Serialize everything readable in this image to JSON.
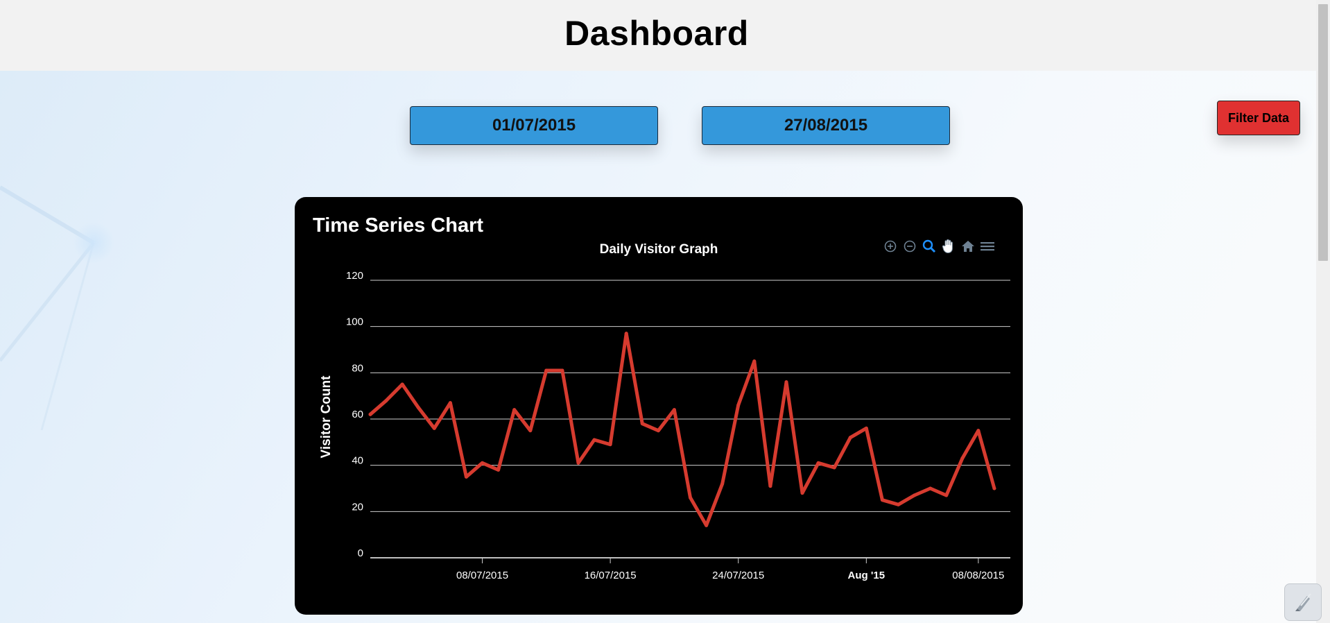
{
  "header": {
    "title": "Dashboard"
  },
  "filters": {
    "start_date": "01/07/2015",
    "end_date": "27/08/2015",
    "filter_label": "Filter Data"
  },
  "card": {
    "title": "Time Series Chart"
  },
  "toolbar": {
    "icons": [
      "zoom-in-icon",
      "zoom-out-icon",
      "zoom-select-icon",
      "pan-hand-icon",
      "home-icon",
      "menu-icon"
    ],
    "active_color": "#1e90ff",
    "inactive_color": "#6e8192"
  },
  "colors": {
    "button_blue": "#3498db",
    "filter_red": "#e03131",
    "series_red": "#d63b2f",
    "card_bg": "#000000"
  },
  "chart_data": {
    "type": "line",
    "title": "Daily Visitor Graph",
    "ylabel": "Visitor Count",
    "xlabel": "",
    "ylim": [
      0,
      120
    ],
    "yticks": [
      0,
      20,
      40,
      60,
      80,
      100,
      120
    ],
    "xlim": [
      "2015-07-01",
      "2015-08-10"
    ],
    "xticks": [
      {
        "date": "2015-07-08",
        "label": "08/07/2015"
      },
      {
        "date": "2015-07-16",
        "label": "16/07/2015"
      },
      {
        "date": "2015-07-24",
        "label": "24/07/2015"
      },
      {
        "date": "2015-08-01",
        "label": "Aug '15",
        "bold": true
      },
      {
        "date": "2015-08-08",
        "label": "08/08/2015"
      }
    ],
    "grid": true,
    "series": [
      {
        "color": "#d63b2f",
        "points": [
          [
            "2015-07-01",
            62
          ],
          [
            "2015-07-02",
            68
          ],
          [
            "2015-07-03",
            75
          ],
          [
            "2015-07-04",
            65
          ],
          [
            "2015-07-05",
            56
          ],
          [
            "2015-07-06",
            67
          ],
          [
            "2015-07-07",
            35
          ],
          [
            "2015-07-08",
            41
          ],
          [
            "2015-07-09",
            38
          ],
          [
            "2015-07-10",
            64
          ],
          [
            "2015-07-11",
            55
          ],
          [
            "2015-07-12",
            81
          ],
          [
            "2015-07-13",
            81
          ],
          [
            "2015-07-14",
            41
          ],
          [
            "2015-07-15",
            51
          ],
          [
            "2015-07-16",
            49
          ],
          [
            "2015-07-17",
            97
          ],
          [
            "2015-07-18",
            58
          ],
          [
            "2015-07-19",
            55
          ],
          [
            "2015-07-20",
            64
          ],
          [
            "2015-07-21",
            26
          ],
          [
            "2015-07-22",
            14
          ],
          [
            "2015-07-23",
            32
          ],
          [
            "2015-07-24",
            66
          ],
          [
            "2015-07-25",
            85
          ],
          [
            "2015-07-26",
            31
          ],
          [
            "2015-07-27",
            76
          ],
          [
            "2015-07-28",
            28
          ],
          [
            "2015-07-29",
            41
          ],
          [
            "2015-07-30",
            39
          ],
          [
            "2015-07-31",
            52
          ],
          [
            "2015-08-01",
            56
          ],
          [
            "2015-08-02",
            25
          ],
          [
            "2015-08-03",
            23
          ],
          [
            "2015-08-04",
            27
          ],
          [
            "2015-08-05",
            30
          ],
          [
            "2015-08-06",
            27
          ],
          [
            "2015-08-07",
            43
          ],
          [
            "2015-08-08",
            55
          ],
          [
            "2015-08-09",
            30
          ]
        ]
      }
    ]
  }
}
